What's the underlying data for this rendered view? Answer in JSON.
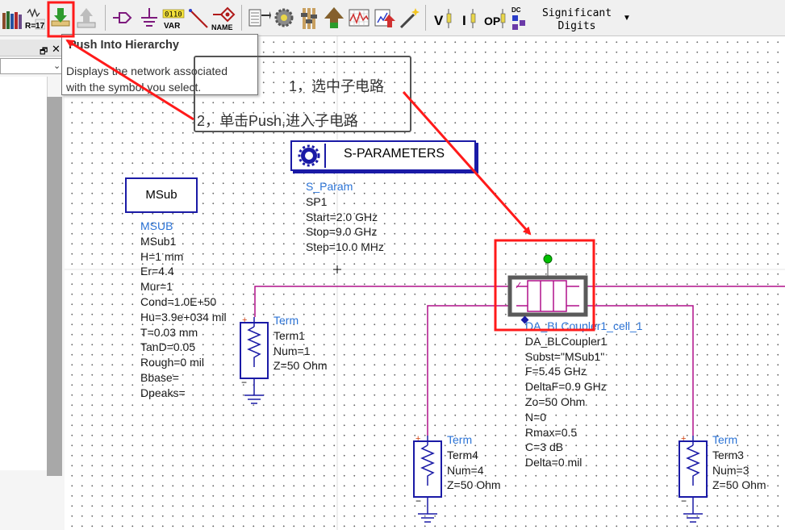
{
  "toolbar": {
    "buttons": [
      {
        "name": "library-icon"
      },
      {
        "name": "resistor-value-icon",
        "label": "R=17"
      },
      {
        "name": "graph-icon"
      },
      {
        "name": "push-into-hierarchy-icon"
      },
      {
        "name": "pop-out-hierarchy-icon"
      },
      {
        "name": "port-icon"
      },
      {
        "name": "ground-icon"
      },
      {
        "name": "var-icon",
        "top": "0110",
        "label": "VAR"
      },
      {
        "name": "wire-icon"
      },
      {
        "name": "name-icon",
        "label": "NAME"
      },
      {
        "name": "edit-component-icon"
      },
      {
        "name": "simulate-settings-icon"
      },
      {
        "name": "tuning-icon"
      },
      {
        "name": "simulate-icon"
      },
      {
        "name": "data-display-icon"
      },
      {
        "name": "optimization-icon"
      },
      {
        "name": "magic-wand-icon"
      },
      {
        "name": "dc-voltage-annotation-icon",
        "label": "V"
      },
      {
        "name": "dc-current-annotation-icon",
        "label": "I"
      },
      {
        "name": "op-annotation-icon",
        "label": "OP"
      },
      {
        "name": "dc-annotation-icon",
        "label": "DC"
      }
    ],
    "significant_digits": {
      "line1": "Significant",
      "line2": "Digits"
    }
  },
  "tooltip": {
    "title": "Push Into Hierarchy",
    "line1": "Displays the network associated",
    "line2": "with the symbol you select."
  },
  "annotations": {
    "step1": "1，选中子电路",
    "step2": "2，单击Push,进入子电路",
    "highlight_color": "#ff0000"
  },
  "schematic": {
    "msub_box": "MSub",
    "msub": [
      "MSUB",
      "MSub1",
      "H=1 mm",
      "Er=4.4",
      "Mur=1",
      "Cond=1.0E+50",
      "Hu=3.9e+034 mil",
      "T=0.03 mm",
      "TanD=0.05",
      "Rough=0 mil",
      "Bbase=",
      "Dpeaks="
    ],
    "sparam_title": "S-PARAMETERS",
    "sparam": [
      "S_Param",
      "SP1",
      "Start=2.0 GHz",
      "Stop=9.0 GHz",
      "Step=10.0 MHz"
    ],
    "term1": [
      "Term",
      "Term1",
      "Num=1",
      "Z=50 Ohm"
    ],
    "coupler": [
      "DA_BLCoupler1_cell_1",
      "DA_BLCoupler1",
      "Subst=\"MSub1\"",
      "F=5.45 GHz",
      "DeltaF=0.9 GHz",
      "Zo=50 Ohm",
      "N=0",
      "Rmax=0.5",
      "C=3 dB",
      "Delta=0 mil"
    ],
    "term4": [
      "Term",
      "Term4",
      "Num=4",
      "Z=50 Ohm"
    ],
    "term3": [
      "Term",
      "Term3",
      "Num=3",
      "Z=50 Ohm"
    ],
    "colors": {
      "wire": "#b0108a",
      "component": "#1a1aa6",
      "label_header": "#2b73d6",
      "node": "#00c000"
    }
  }
}
